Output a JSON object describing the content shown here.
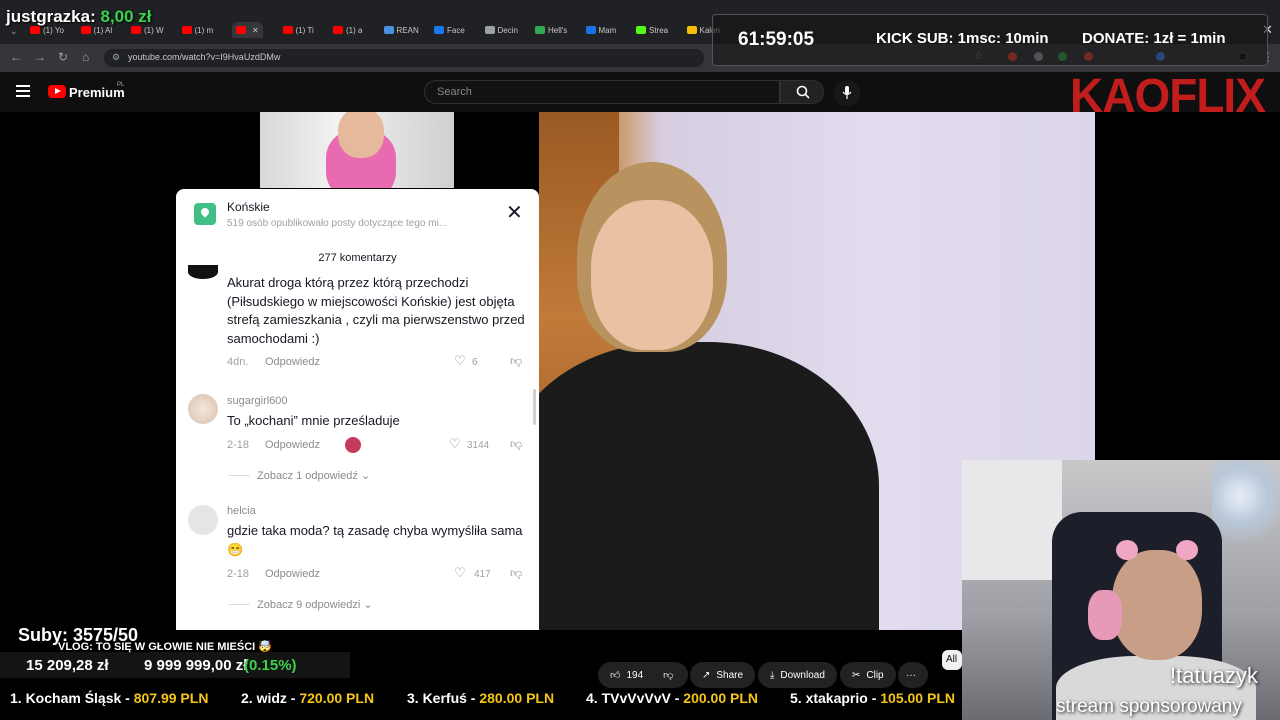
{
  "browser": {
    "tabs": [
      {
        "label": "(1) Yo",
        "color": "#ff0000"
      },
      {
        "label": "(1) Al",
        "color": "#ff0000"
      },
      {
        "label": "(1) W",
        "color": "#ff0000"
      },
      {
        "label": "(1) m",
        "color": "#ff0000"
      },
      {
        "label": "",
        "color": "#ff0000"
      },
      {
        "label": "(1) Ti",
        "color": "#ff0000"
      },
      {
        "label": "(1) a",
        "color": "#ff0000"
      },
      {
        "label": "REAN",
        "color": "#4a90e2"
      },
      {
        "label": "Face",
        "color": "#1877f2"
      },
      {
        "label": "Decin",
        "color": "#9aa0a6"
      },
      {
        "label": "Hell's",
        "color": "#34a853"
      },
      {
        "label": "Mam",
        "color": "#1a73e8"
      },
      {
        "label": "Strea",
        "color": "#53fc18"
      },
      {
        "label": "Kalen",
        "color": "#fbbc04"
      }
    ],
    "url": "youtube.com/watch?v=I9HvaUzdDMw"
  },
  "overlay": {
    "streamer_name": "justgrazka:",
    "streamer_amount": "8,00 zł",
    "timer": "61:59:05",
    "kick_sub": "KICK SUB: 1msc: 10min",
    "donate": "DONATE: 1zł = 1min",
    "logo_text": "KAOFLIX",
    "subs": "Suby: 3575/50",
    "vlog_title": "VLOG: TO SIĘ W GŁOWIE NIE MIEŚCI 🤯",
    "goal_current": "15 209,28 zł",
    "goal_target": "9 999 999,00 zł",
    "goal_percent": "(0.15%)",
    "command": "!tatuazyk",
    "sponsor": "stream sponsorowany",
    "ticker": [
      {
        "rank": "1. Kocham Śląsk - ",
        "amount": "807.99 PLN"
      },
      {
        "rank": "2. widz - ",
        "amount": "720.00 PLN"
      },
      {
        "rank": "3. Kerfuś - ",
        "amount": "280.00 PLN"
      },
      {
        "rank": "4. TVvVvVvV - ",
        "amount": "200.00 PLN"
      },
      {
        "rank": "5. xtakaprio - ",
        "amount": "105.00 PLN"
      }
    ]
  },
  "youtube": {
    "brand": "Premium",
    "brand_region": "PL",
    "search_placeholder": "Search",
    "actions": {
      "likes": "194",
      "share": "Share",
      "download": "Download",
      "clip": "Clip",
      "more": "···",
      "chip_all": "All"
    }
  },
  "comments_panel": {
    "location_title": "Końskie",
    "location_sub": "519 osób opublikowało posty dotyczące tego mi...",
    "count": "277 komentarzy",
    "comments": [
      {
        "user": "",
        "text": "Akurat droga którą przez którą przechodzi (Piłsudskiego w miejscowości Końskie) jest objęta strefą zamieszkania , czyli ma pierwszenstwo przed samochodami :)",
        "date": "4dn.",
        "reply": "Odpowiedz",
        "likes": "6"
      },
      {
        "user": "sugargirl600",
        "text": "To „kochani” mnie prześladuje",
        "date": "2-18",
        "reply": "Odpowiedz",
        "likes": "3144",
        "view_replies": "Zobacz 1 odpowiedź ⌄"
      },
      {
        "user": "helcia",
        "text": "gdzie taka moda? tą zasadę chyba wymyśliła sama 😁",
        "date": "2-18",
        "reply": "Odpowiedz",
        "likes": "417",
        "view_replies": "Zobacz 9 odpowiedzi ⌄"
      }
    ]
  }
}
